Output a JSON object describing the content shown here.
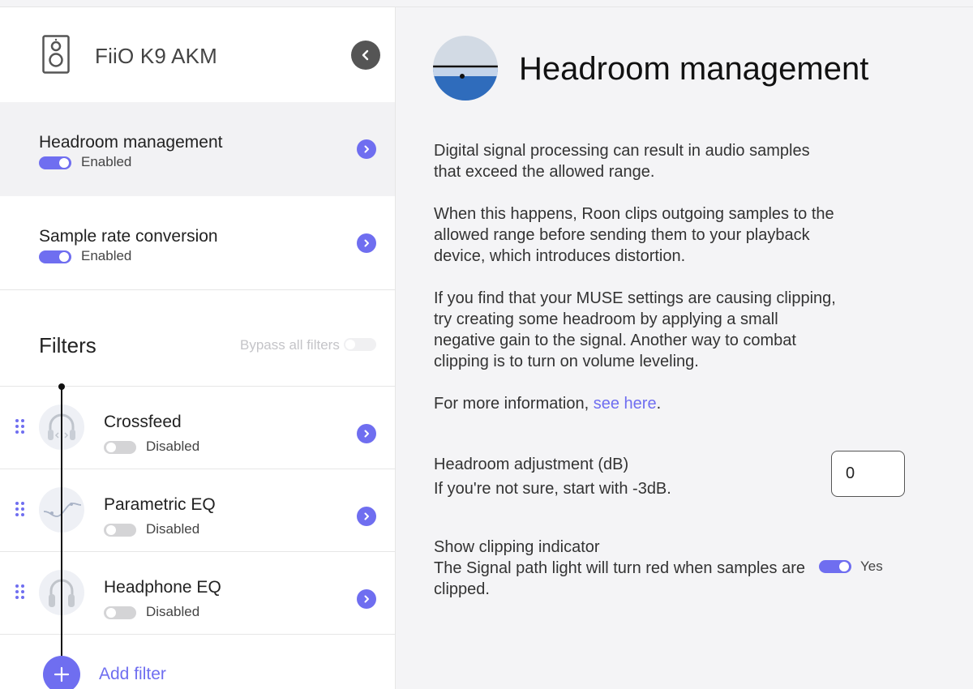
{
  "device": {
    "name": "FiiO K9 AKM"
  },
  "settings": [
    {
      "title": "Headroom management",
      "status": "Enabled",
      "enabled": true,
      "active": true
    },
    {
      "title": "Sample rate conversion",
      "status": "Enabled",
      "enabled": true,
      "active": false
    }
  ],
  "filters": {
    "title": "Filters",
    "bypass_label": "Bypass all filters",
    "bypass_enabled": false,
    "items": [
      {
        "name": "Crossfeed",
        "status": "Disabled",
        "enabled": false,
        "icon": "headphones-icon"
      },
      {
        "name": "Parametric EQ",
        "status": "Disabled",
        "enabled": false,
        "icon": "eq-curve-icon"
      },
      {
        "name": "Headphone EQ",
        "status": "Disabled",
        "enabled": false,
        "icon": "headphone-eq-icon"
      }
    ],
    "add_label": "Add filter"
  },
  "main": {
    "title": "Headroom management",
    "paragraphs": [
      "Digital signal processing can result in audio samples that exceed the allowed range.",
      "When this happens, Roon clips outgoing samples to the allowed range before sending them to your playback device, which introduces distortion.",
      "If you find that your MUSE settings are causing clipping, try creating some headroom by applying a small negative gain to the signal. Another way to combat clipping is to turn on volume leveling."
    ],
    "more_info_prefix": "For more information, ",
    "more_info_link": "see here",
    "more_info_suffix": ".",
    "adjustment_label": "Headroom adjustment (dB)",
    "adjustment_hint": "If you're not sure, start with -3dB.",
    "adjustment_value": "0",
    "clipping_title": "Show clipping indicator",
    "clipping_desc": "The Signal path light will turn red when samples are clipped.",
    "clipping_status": "Yes",
    "clipping_enabled": true
  },
  "colors": {
    "accent": "#6f6ef0",
    "hero_top": "#d2dae4",
    "hero_bottom": "#2f6cbc"
  }
}
